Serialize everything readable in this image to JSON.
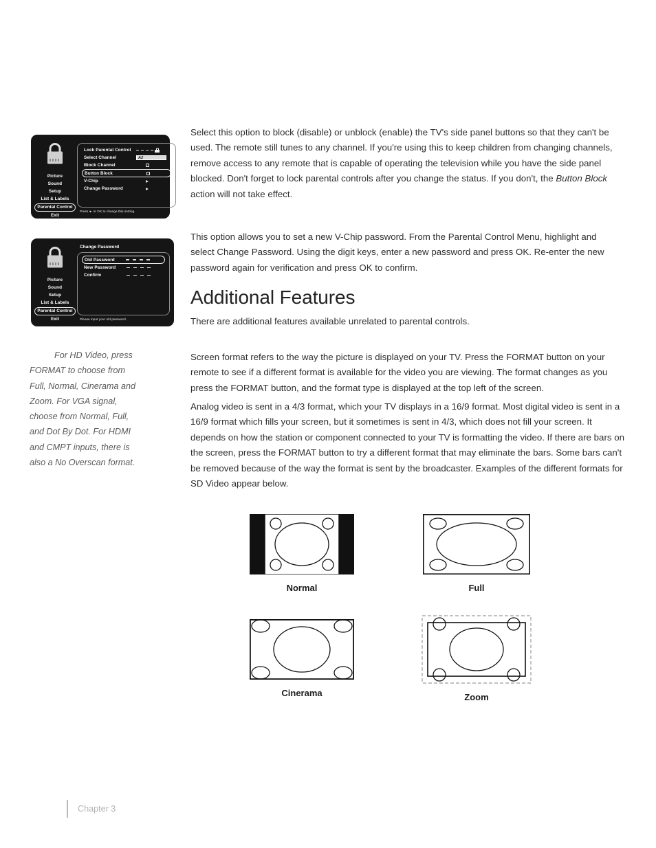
{
  "menu_parental": {
    "nav_items": [
      {
        "label": "Picture",
        "selected": false
      },
      {
        "label": "Sound",
        "selected": false
      },
      {
        "label": "Setup",
        "selected": false
      },
      {
        "label": "List & Labels",
        "selected": false
      },
      {
        "label": "Parental Control",
        "selected": true
      },
      {
        "label": "Exit",
        "selected": false
      }
    ],
    "rows": [
      {
        "label": "Lock Parental Control",
        "value_type": "dashes-lock",
        "value": "- - - -"
      },
      {
        "label": "Select Channel",
        "value_type": "field",
        "value": "A2"
      },
      {
        "label": "Block Channel",
        "value_type": "checkbox",
        "value": ""
      },
      {
        "label": "Button Block",
        "value_type": "checkbox",
        "value": "",
        "highlighted": true
      },
      {
        "label": "V-Chip",
        "value_type": "arrow",
        "value": ""
      },
      {
        "label": "Change Password",
        "value_type": "arrow",
        "value": ""
      }
    ],
    "footer": "Press ► or OK to change this setting."
  },
  "menu_password": {
    "title": "Change Password",
    "nav_items": [
      {
        "label": "Picture",
        "selected": false
      },
      {
        "label": "Sound",
        "selected": false
      },
      {
        "label": "Setup",
        "selected": false
      },
      {
        "label": "List & Labels",
        "selected": false
      },
      {
        "label": "Parental Control",
        "selected": true
      },
      {
        "label": "Exit",
        "selected": false
      }
    ],
    "rows": [
      {
        "label": "Old Password",
        "highlighted": true
      },
      {
        "label": "New Password",
        "highlighted": false
      },
      {
        "label": "Confirm",
        "highlighted": false
      }
    ],
    "footer": "Please input your old password."
  },
  "side_note": "For HD Video, press FORMAT to choose from Full, Normal, Cinerama and Zoom. For VGA signal, choose from Normal, Full, and Dot By Dot. For HDMI and CMPT inputs, there is also a No Overscan format.",
  "body": {
    "p_button_block_a": "Select this option to block (disable) or unblock (enable) the TV's side panel buttons so that they can't be used. The remote still tunes to any channel. If you're using this to keep children from changing channels, remove access to any remote that is capable of operating the television while you have the side panel blocked. Don't forget to lock parental controls after you change the status. If you don't, the ",
    "p_button_block_italic": "Button Block",
    "p_button_block_b": " action will not take effect.",
    "p_change_password": "This option allows you to set a new V-Chip password. From the Parental Control Menu, highlight and select Change Password. Using the digit keys, enter a new password and press OK. Re-enter the new password again for verification and press OK to confirm.",
    "heading_additional_features": "Additional Features",
    "p_additional_intro": "There are additional features available unrelated to parental controls.",
    "p_screen_format": "Screen format refers to the way the picture is displayed on your TV. Press the FORMAT button on your remote to see if a different format is available for the video you are viewing. The format changes as you press the FORMAT button, and the format type is displayed at the top left of the screen.",
    "p_analog_video": "Analog video is sent in a 4/3 format, which your TV displays in a 16/9 format. Most digital video is sent in a 16/9 format which fills your screen, but it sometimes is sent in 4/3, which does not fill your screen. It depends on how the station or component connected to your TV is formatting the video. If there are bars on the screen, press the FORMAT button to try a different format that may eliminate the bars. Some bars can't be removed because of the way the format is sent by the broadcaster. Examples of the different formats for SD Video appear below."
  },
  "format_examples": [
    {
      "caption": "Normal"
    },
    {
      "caption": "Full"
    },
    {
      "caption": "Cinerama"
    },
    {
      "caption": "Zoom"
    }
  ],
  "footer": {
    "chapter": "Chapter 3"
  }
}
